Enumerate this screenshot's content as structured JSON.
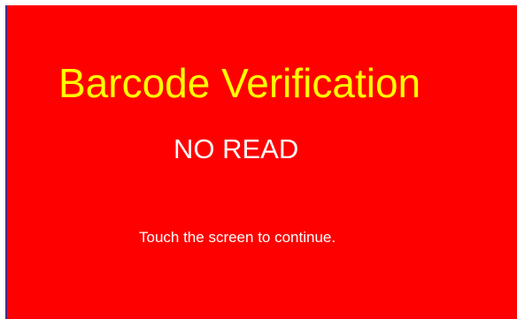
{
  "screen": {
    "title": "Barcode Verification",
    "status": "NO READ",
    "prompt": "Touch the screen to continue."
  },
  "colors": {
    "background": "#ff0000",
    "title": "#ffff00",
    "text": "#ffffff",
    "left_edge": "#4a2a8a"
  }
}
